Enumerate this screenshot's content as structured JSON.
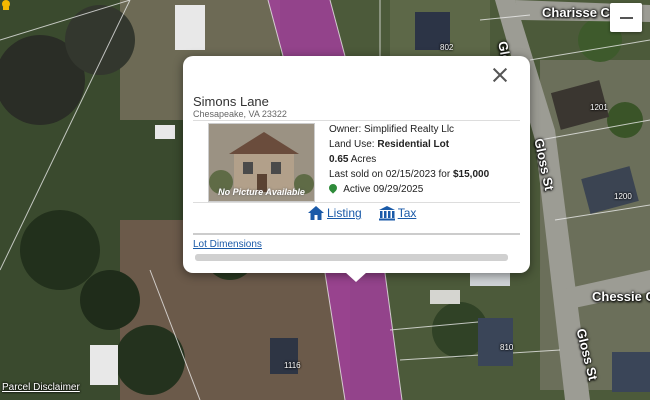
{
  "map": {
    "streets": [
      "Charisse Ct",
      "Gloss St",
      "Gloss St",
      "Gloss St",
      "Chessie Ct"
    ],
    "lot_numbers": [
      "802",
      "1201",
      "1200",
      "810",
      "1116"
    ],
    "disclaimer": "Parcel Disclaimer",
    "colors": {
      "highlight_parcel": "#a0409a",
      "road": "#9c9c94"
    }
  },
  "popup": {
    "title": "Simons Lane",
    "address": "Chesapeake, VA 23322",
    "photo_caption": "No Picture Available",
    "owner_label": "Owner:",
    "owner": "Simplified Realty Llc",
    "land_use_label": "Land Use:",
    "land_use": "Residential Lot",
    "acres_value": "0.65",
    "acres_unit": "Acres",
    "last_sold_prefix": "Last sold on 02/15/2023 for",
    "last_sold_price": "$15,000",
    "active_text": "Active 09/29/2025",
    "listing_link": "Listing",
    "tax_link": "Tax",
    "lot_dimensions_link": "Lot Dimensions",
    "colors": {
      "link": "#1a5aa8",
      "active_pin": "#2e8b3a"
    }
  },
  "icons": [
    "close-icon",
    "home-icon",
    "bank-icon",
    "map-pin-icon",
    "zoom-in-icon",
    "pegman-icon"
  ]
}
